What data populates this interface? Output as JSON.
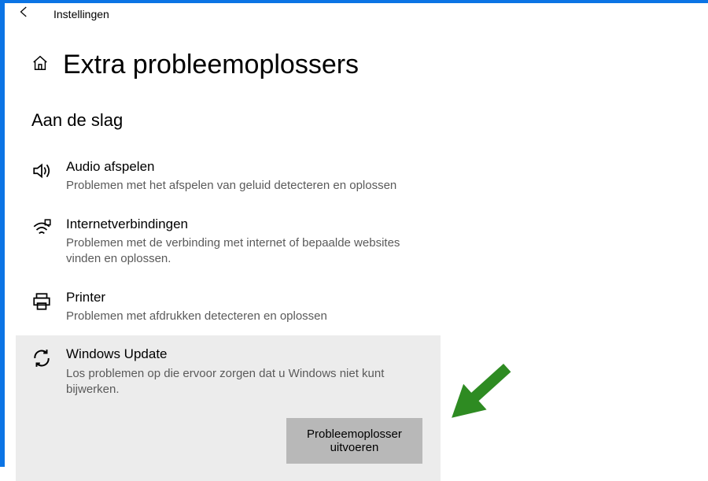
{
  "topbar": {
    "app_title": "Instellingen"
  },
  "header": {
    "title": "Extra probleemoplossers"
  },
  "section": {
    "title": "Aan de slag"
  },
  "items": [
    {
      "title": "Audio afspelen",
      "desc": "Problemen met het afspelen van geluid detecteren en oplossen"
    },
    {
      "title": "Internetverbindingen",
      "desc": "Problemen met de verbinding met internet of bepaalde websites vinden en oplossen."
    },
    {
      "title": "Printer",
      "desc": "Problemen met afdrukken detecteren en oplossen"
    },
    {
      "title": "Windows Update",
      "desc": "Los problemen op die ervoor zorgen dat u Windows niet kunt bijwerken."
    }
  ],
  "run_button": {
    "label": "Probleemoplosser uitvoeren"
  }
}
